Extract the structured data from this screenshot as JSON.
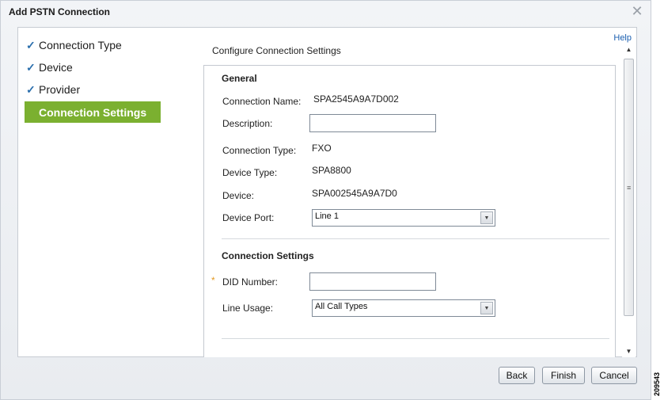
{
  "dialog": {
    "title": "Add PSTN Connection",
    "close_symbol": "✕"
  },
  "wizard": {
    "steps": [
      {
        "label": "Connection Type",
        "done": true
      },
      {
        "label": "Device",
        "done": true
      },
      {
        "label": "Provider",
        "done": true
      },
      {
        "label": "Connection Settings",
        "done": false,
        "active": true
      }
    ],
    "check_symbol": "✓"
  },
  "help": {
    "label": "Help"
  },
  "heading": "Configure Connection Settings",
  "general": {
    "title": "General",
    "connection_name": {
      "label": "Connection Name:",
      "value": "SPA2545A9A7D002"
    },
    "description": {
      "label": "Description:",
      "value": ""
    },
    "connection_type": {
      "label": "Connection Type:",
      "value": "FXO"
    },
    "device_type": {
      "label": "Device Type:",
      "value": "SPA8800"
    },
    "device": {
      "label": "Device:",
      "value": "SPA002545A9A7D0"
    },
    "device_port": {
      "label": "Device Port:",
      "value": "Line 1"
    }
  },
  "connection_settings": {
    "title": "Connection Settings",
    "required_mark": "*",
    "did_number": {
      "label": "DID Number:",
      "value": ""
    },
    "line_usage": {
      "label": "Line Usage:",
      "value": "All Call Types"
    }
  },
  "footer": {
    "back_label": "Back",
    "finish_label": "Finish",
    "cancel_label": "Cancel"
  },
  "figure_code": "209543",
  "colors": {
    "active_step": "#7bb030",
    "check": "#2b6fad",
    "link": "#1b5fb0",
    "required": "#e39a23"
  }
}
